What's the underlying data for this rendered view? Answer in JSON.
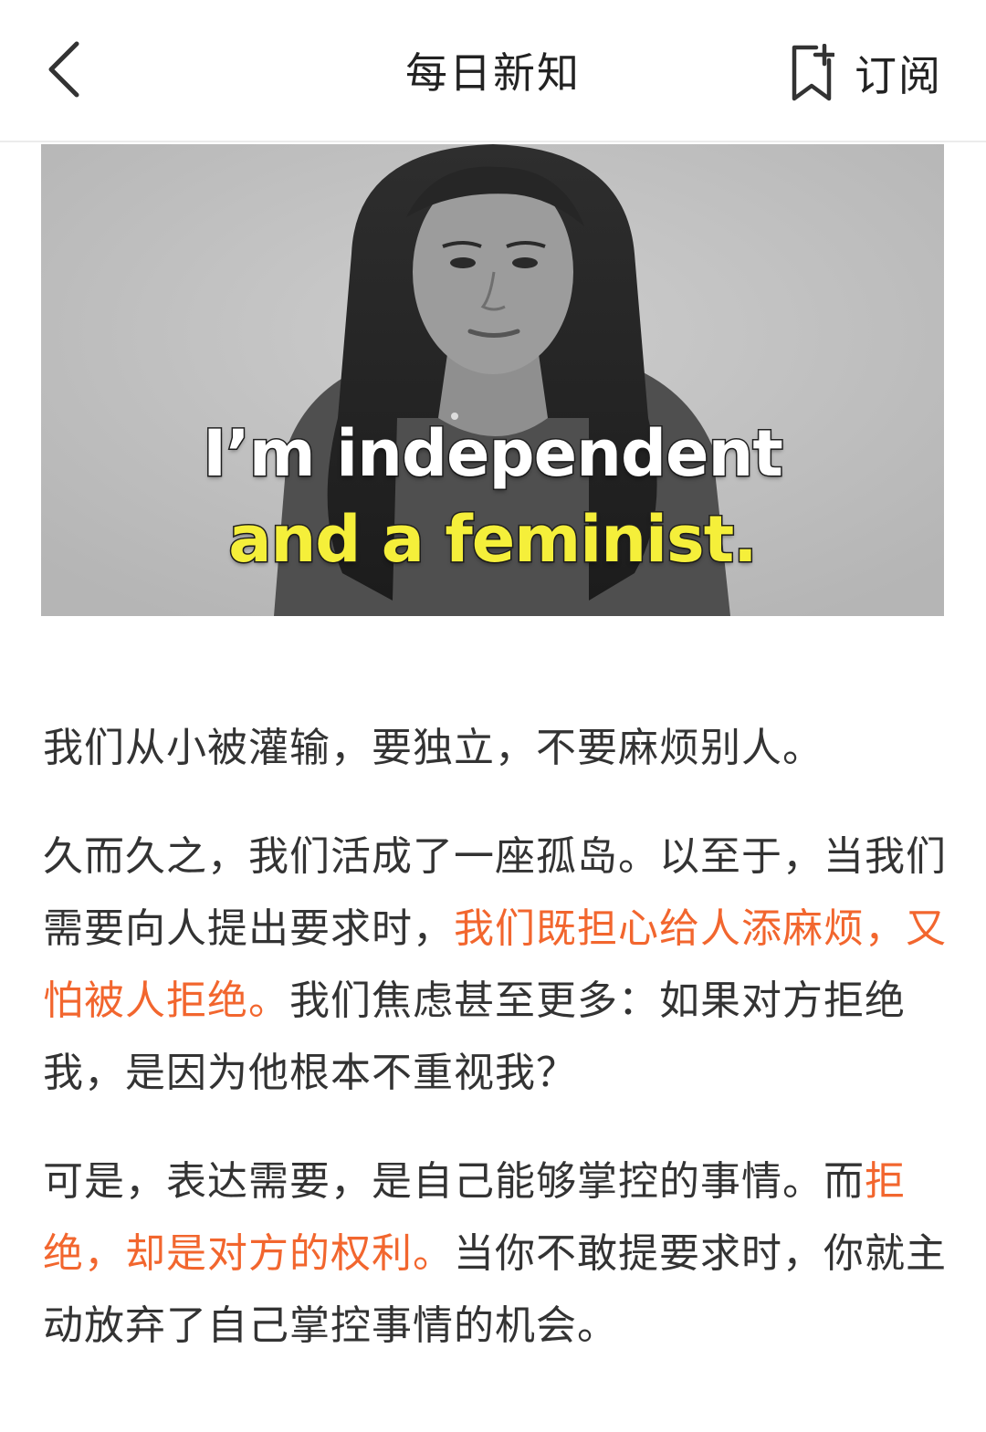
{
  "navbar": {
    "title": "每日新知",
    "back_icon": "chevron-left-icon",
    "subscribe_icon": "bookmark-add-icon",
    "subscribe_label": "订阅"
  },
  "hero": {
    "caption_line1": "I’m independent",
    "caption_line2": "and a feminist.",
    "caption_color_line1": "#ffffff",
    "caption_color_line2": "#f5ef3a"
  },
  "article": {
    "highlight_color": "#f2662e",
    "p1": {
      "text": "我们从小被灌输，要独立，不要麻烦别人。"
    },
    "p2": {
      "seg1": "久而久之，我们活成了一座孤岛。以至于，当我们需要向人提出要求时，",
      "seg2_highlight": "我们既担心给人添麻烦，又怕被人拒绝。",
      "seg3": "我们焦虑甚至更多：如果对方拒绝我，是因为他根本不重视我？"
    },
    "p3": {
      "seg1": "可是，表达需要，是自己能够掌控的事情。而",
      "seg2_highlight": "拒绝，却是对方的权利。",
      "seg3": "当你不敢提要求时，你就主动放弃了自己掌控事情的机会。"
    }
  }
}
